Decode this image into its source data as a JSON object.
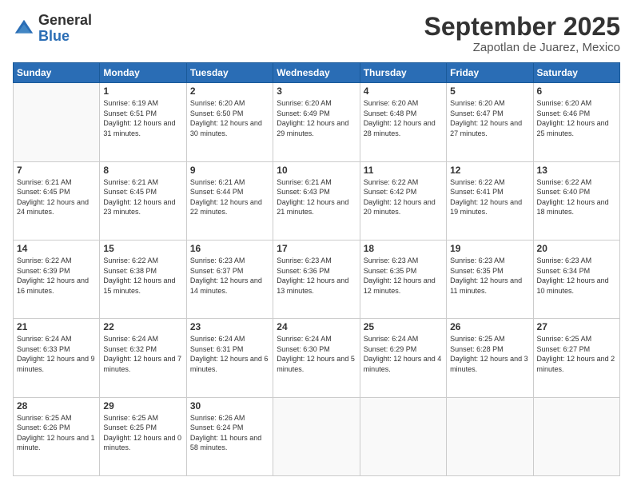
{
  "header": {
    "logo": {
      "general": "General",
      "blue": "Blue"
    },
    "title": "September 2025",
    "subtitle": "Zapotlan de Juarez, Mexico"
  },
  "weekdays": [
    "Sunday",
    "Monday",
    "Tuesday",
    "Wednesday",
    "Thursday",
    "Friday",
    "Saturday"
  ],
  "weeks": [
    [
      {
        "day": "",
        "empty": true
      },
      {
        "day": "1",
        "sunrise": "Sunrise: 6:19 AM",
        "sunset": "Sunset: 6:51 PM",
        "daylight": "Daylight: 12 hours and 31 minutes."
      },
      {
        "day": "2",
        "sunrise": "Sunrise: 6:20 AM",
        "sunset": "Sunset: 6:50 PM",
        "daylight": "Daylight: 12 hours and 30 minutes."
      },
      {
        "day": "3",
        "sunrise": "Sunrise: 6:20 AM",
        "sunset": "Sunset: 6:49 PM",
        "daylight": "Daylight: 12 hours and 29 minutes."
      },
      {
        "day": "4",
        "sunrise": "Sunrise: 6:20 AM",
        "sunset": "Sunset: 6:48 PM",
        "daylight": "Daylight: 12 hours and 28 minutes."
      },
      {
        "day": "5",
        "sunrise": "Sunrise: 6:20 AM",
        "sunset": "Sunset: 6:47 PM",
        "daylight": "Daylight: 12 hours and 27 minutes."
      },
      {
        "day": "6",
        "sunrise": "Sunrise: 6:20 AM",
        "sunset": "Sunset: 6:46 PM",
        "daylight": "Daylight: 12 hours and 25 minutes."
      }
    ],
    [
      {
        "day": "7",
        "sunrise": "Sunrise: 6:21 AM",
        "sunset": "Sunset: 6:45 PM",
        "daylight": "Daylight: 12 hours and 24 minutes."
      },
      {
        "day": "8",
        "sunrise": "Sunrise: 6:21 AM",
        "sunset": "Sunset: 6:45 PM",
        "daylight": "Daylight: 12 hours and 23 minutes."
      },
      {
        "day": "9",
        "sunrise": "Sunrise: 6:21 AM",
        "sunset": "Sunset: 6:44 PM",
        "daylight": "Daylight: 12 hours and 22 minutes."
      },
      {
        "day": "10",
        "sunrise": "Sunrise: 6:21 AM",
        "sunset": "Sunset: 6:43 PM",
        "daylight": "Daylight: 12 hours and 21 minutes."
      },
      {
        "day": "11",
        "sunrise": "Sunrise: 6:22 AM",
        "sunset": "Sunset: 6:42 PM",
        "daylight": "Daylight: 12 hours and 20 minutes."
      },
      {
        "day": "12",
        "sunrise": "Sunrise: 6:22 AM",
        "sunset": "Sunset: 6:41 PM",
        "daylight": "Daylight: 12 hours and 19 minutes."
      },
      {
        "day": "13",
        "sunrise": "Sunrise: 6:22 AM",
        "sunset": "Sunset: 6:40 PM",
        "daylight": "Daylight: 12 hours and 18 minutes."
      }
    ],
    [
      {
        "day": "14",
        "sunrise": "Sunrise: 6:22 AM",
        "sunset": "Sunset: 6:39 PM",
        "daylight": "Daylight: 12 hours and 16 minutes."
      },
      {
        "day": "15",
        "sunrise": "Sunrise: 6:22 AM",
        "sunset": "Sunset: 6:38 PM",
        "daylight": "Daylight: 12 hours and 15 minutes."
      },
      {
        "day": "16",
        "sunrise": "Sunrise: 6:23 AM",
        "sunset": "Sunset: 6:37 PM",
        "daylight": "Daylight: 12 hours and 14 minutes."
      },
      {
        "day": "17",
        "sunrise": "Sunrise: 6:23 AM",
        "sunset": "Sunset: 6:36 PM",
        "daylight": "Daylight: 12 hours and 13 minutes."
      },
      {
        "day": "18",
        "sunrise": "Sunrise: 6:23 AM",
        "sunset": "Sunset: 6:35 PM",
        "daylight": "Daylight: 12 hours and 12 minutes."
      },
      {
        "day": "19",
        "sunrise": "Sunrise: 6:23 AM",
        "sunset": "Sunset: 6:35 PM",
        "daylight": "Daylight: 12 hours and 11 minutes."
      },
      {
        "day": "20",
        "sunrise": "Sunrise: 6:23 AM",
        "sunset": "Sunset: 6:34 PM",
        "daylight": "Daylight: 12 hours and 10 minutes."
      }
    ],
    [
      {
        "day": "21",
        "sunrise": "Sunrise: 6:24 AM",
        "sunset": "Sunset: 6:33 PM",
        "daylight": "Daylight: 12 hours and 9 minutes."
      },
      {
        "day": "22",
        "sunrise": "Sunrise: 6:24 AM",
        "sunset": "Sunset: 6:32 PM",
        "daylight": "Daylight: 12 hours and 7 minutes."
      },
      {
        "day": "23",
        "sunrise": "Sunrise: 6:24 AM",
        "sunset": "Sunset: 6:31 PM",
        "daylight": "Daylight: 12 hours and 6 minutes."
      },
      {
        "day": "24",
        "sunrise": "Sunrise: 6:24 AM",
        "sunset": "Sunset: 6:30 PM",
        "daylight": "Daylight: 12 hours and 5 minutes."
      },
      {
        "day": "25",
        "sunrise": "Sunrise: 6:24 AM",
        "sunset": "Sunset: 6:29 PM",
        "daylight": "Daylight: 12 hours and 4 minutes."
      },
      {
        "day": "26",
        "sunrise": "Sunrise: 6:25 AM",
        "sunset": "Sunset: 6:28 PM",
        "daylight": "Daylight: 12 hours and 3 minutes."
      },
      {
        "day": "27",
        "sunrise": "Sunrise: 6:25 AM",
        "sunset": "Sunset: 6:27 PM",
        "daylight": "Daylight: 12 hours and 2 minutes."
      }
    ],
    [
      {
        "day": "28",
        "sunrise": "Sunrise: 6:25 AM",
        "sunset": "Sunset: 6:26 PM",
        "daylight": "Daylight: 12 hours and 1 minute."
      },
      {
        "day": "29",
        "sunrise": "Sunrise: 6:25 AM",
        "sunset": "Sunset: 6:25 PM",
        "daylight": "Daylight: 12 hours and 0 minutes."
      },
      {
        "day": "30",
        "sunrise": "Sunrise: 6:26 AM",
        "sunset": "Sunset: 6:24 PM",
        "daylight": "Daylight: 11 hours and 58 minutes."
      },
      {
        "day": "",
        "empty": true
      },
      {
        "day": "",
        "empty": true
      },
      {
        "day": "",
        "empty": true
      },
      {
        "day": "",
        "empty": true
      }
    ]
  ]
}
